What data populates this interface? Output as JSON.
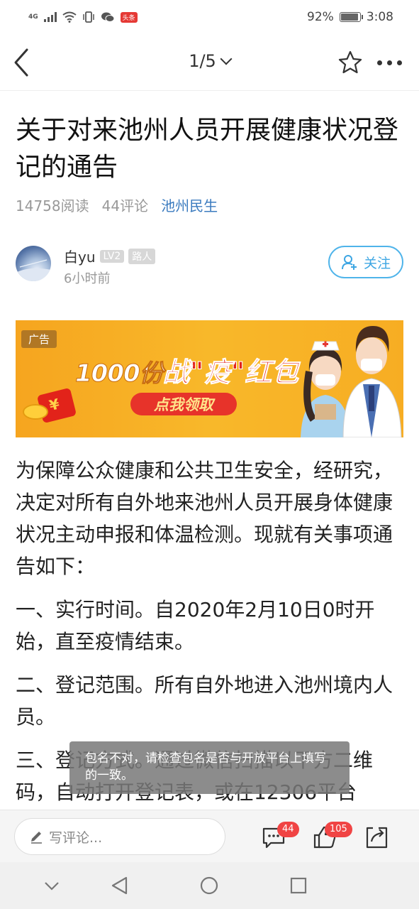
{
  "status_bar": {
    "signal_label": "4G",
    "app_badge": "头条",
    "battery_percent": "92%",
    "battery_level": 0.92,
    "time": "3:08"
  },
  "nav": {
    "page_indicator": "1/5"
  },
  "article": {
    "title": "关于对来池州人员开展健康状况登记的通告",
    "reads": "14758阅读",
    "comments": "44评论",
    "source": "池州民生",
    "author": {
      "name": "白yu",
      "level": "LV2",
      "role": "路人",
      "time": "6小时前"
    },
    "follow_label": "关注",
    "paragraphs": [
      "为保障公众健康和公共卫生安全，经研究，决定对所有自外地来池州人员开展身体健康状况主动申报和体温检测。现就有关事项通告如下：",
      "一、实行时间。自2020年2月10日0时开始，直至疫情结束。",
      "二、登记范围。所有自外地进入池州境内人员。",
      "三、登记方式。通过微信扫描以下方二维码，自动打开登记表，或在12306平台"
    ]
  },
  "ad": {
    "tag": "广告",
    "headline_prefix": "1000份",
    "headline_red": "战\"疫\"红包",
    "cta": "点我领取"
  },
  "toast": {
    "message": "包名不对，请检查包名是否与开放平台上填写的一致。"
  },
  "comment_bar": {
    "placeholder": "写评论...",
    "comment_count": "44",
    "like_count": "105"
  },
  "colors": {
    "accent_blue": "#3da6e3",
    "source_blue": "#3b7bbf",
    "ad_orange": "#f8b82a",
    "badge_red": "#f04444"
  }
}
